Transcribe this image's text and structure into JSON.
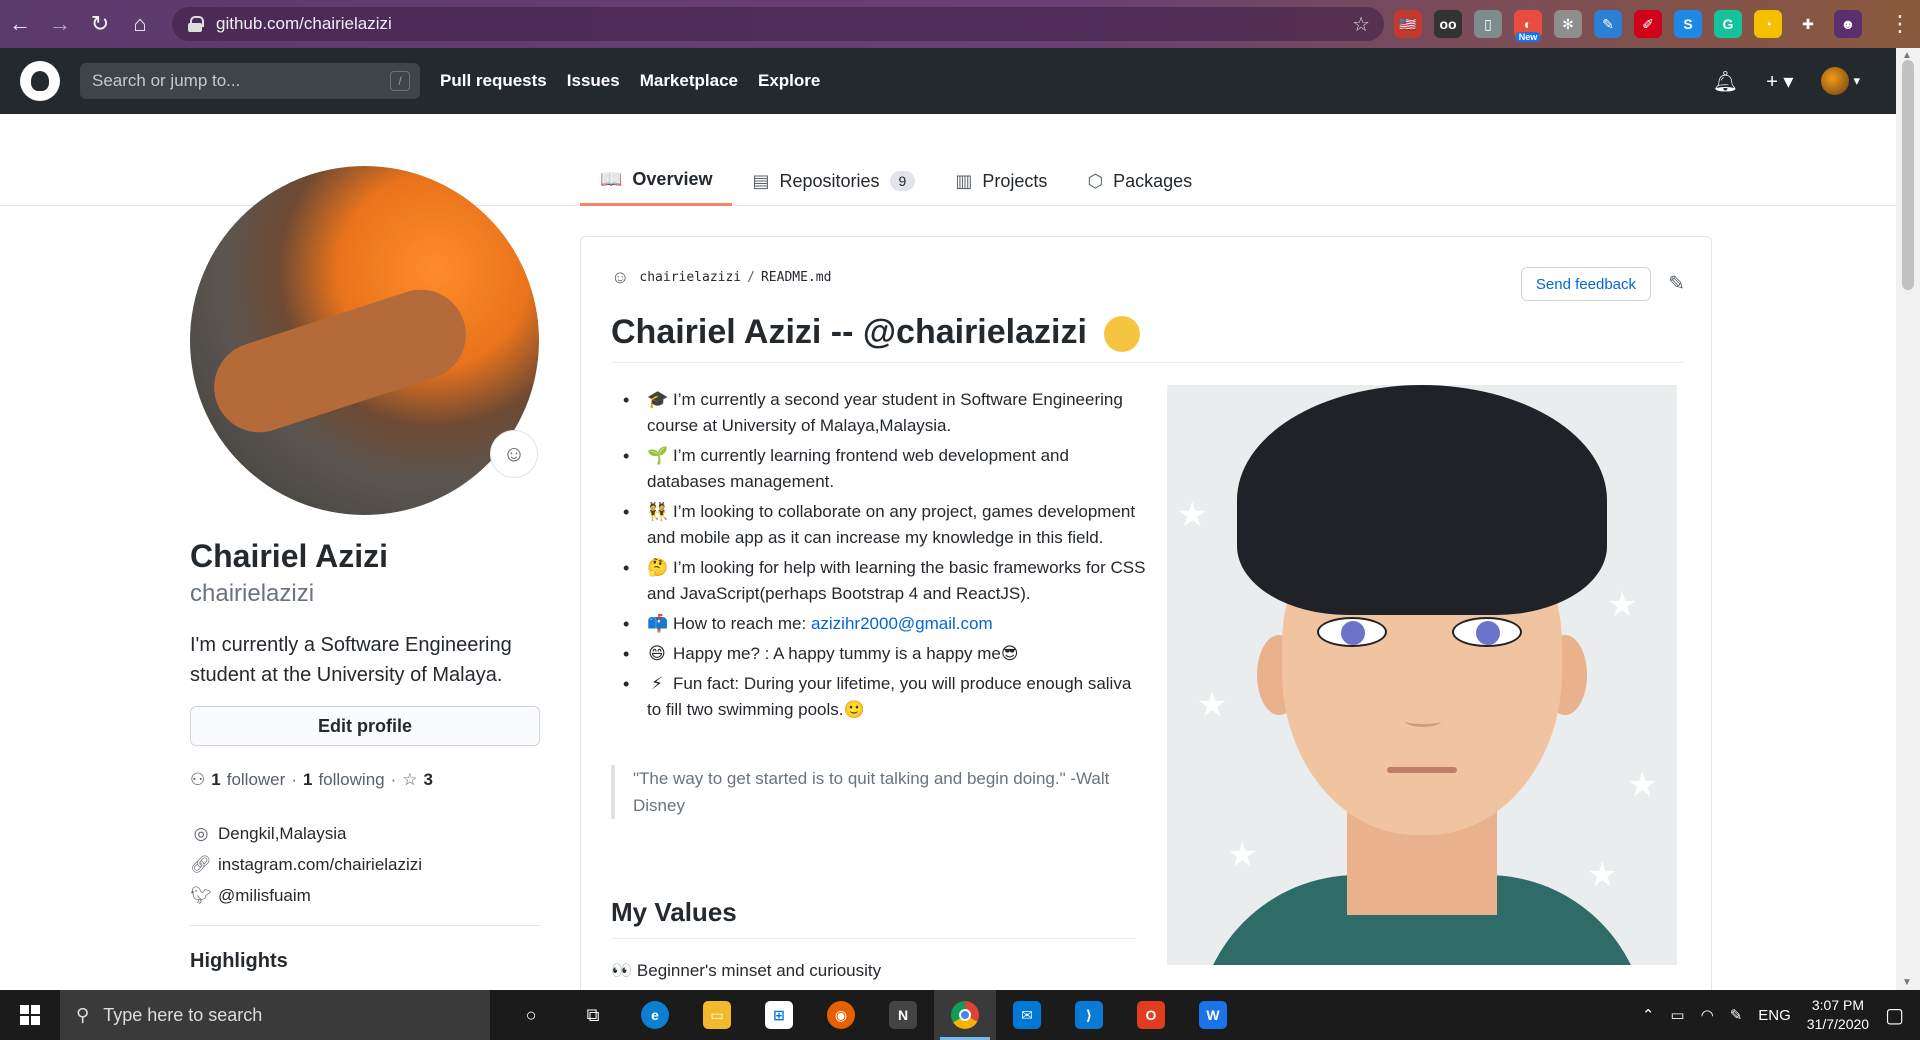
{
  "browser": {
    "url": "github.com/chairielazizi",
    "extensions": [
      {
        "name": "flag-extension",
        "color": "#c0392b",
        "label": "🇺🇸"
      },
      {
        "name": "glasses-extension",
        "color": "#333333",
        "label": "oo"
      },
      {
        "name": "doc-extension",
        "color": "#7f8c8d",
        "label": "▯"
      },
      {
        "name": "new-extension",
        "color": "#e74c3c",
        "label": "◐",
        "badge": "New"
      },
      {
        "name": "gear-extension",
        "color": "#8e8e8e",
        "label": "✻"
      },
      {
        "name": "feather-extension",
        "color": "#2d7fd3",
        "label": "✎"
      },
      {
        "name": "pdf-extension",
        "color": "#d0021b",
        "label": "✐"
      },
      {
        "name": "s-extension",
        "color": "#1e88e5",
        "label": "S"
      },
      {
        "name": "grammarly-extension",
        "color": "#15c39a",
        "label": "G"
      },
      {
        "name": "pacman-extension",
        "color": "#f5c000",
        "label": "◔"
      },
      {
        "name": "puzzle-extension",
        "color": "transparent",
        "label": "✚"
      },
      {
        "name": "profile-extension",
        "color": "#5a2f6e",
        "label": "☻"
      }
    ]
  },
  "gh": {
    "search_placeholder": "Search or jump to...",
    "slash": "/",
    "nav": [
      "Pull requests",
      "Issues",
      "Marketplace",
      "Explore"
    ],
    "plus": "+ ▾",
    "avatar_caret": "▾"
  },
  "tabs": [
    {
      "label": "Overview",
      "icon": "book-icon",
      "glyph": "📖",
      "active": true
    },
    {
      "label": "Repositories",
      "icon": "repo-icon",
      "glyph": "▤",
      "count": "9"
    },
    {
      "label": "Projects",
      "icon": "project-icon",
      "glyph": "▥"
    },
    {
      "label": "Packages",
      "icon": "package-icon",
      "glyph": "⬡"
    }
  ],
  "profile": {
    "fullname": "Chairiel Azizi",
    "username": "chairielazizi",
    "bio": "I'm currently a Software Engineering student at the University of Malaya.",
    "edit_label": "Edit profile",
    "followers": "1",
    "followers_label": "follower",
    "following": "1",
    "following_label": "following",
    "stars": "3",
    "location": "Dengkil,Malaysia",
    "website": "instagram.com/chairielazizi",
    "twitter": "@milisfuaim",
    "highlights": "Highlights"
  },
  "readme": {
    "owner": "chairielazizi",
    "sep": "/",
    "file": "README.md",
    "feedback": "Send feedback",
    "title": "Chairiel Azizi -- @chairielazizi",
    "bullets": [
      {
        "emoji": "🎓",
        "text": "I’m currently a second year student in Software Engineering course at University of Malaya,Malaysia."
      },
      {
        "emoji": "🌱",
        "text": "I’m currently learning frontend web development and databases management."
      },
      {
        "emoji": "👯",
        "text": "I’m looking to collaborate on any project, games development and mobile app as it can increase my knowledge in this field."
      },
      {
        "emoji": "🤔",
        "text": "I’m looking for help with learning the basic frameworks for CSS and JavaScript(perhaps Bootstrap 4 and ReactJS)."
      },
      {
        "emoji": "📫",
        "text": "How to reach me: ",
        "link": "azizihr2000@gmail.com"
      },
      {
        "emoji": "😄",
        "text": "Happy me? : A happy tummy is a happy me😎"
      },
      {
        "emoji": "⚡",
        "text": "Fun fact: During your lifetime, you will produce enough saliva to fill two swimming pools.🙂"
      }
    ],
    "quote": "\"The way to get started is to quit talking and begin doing.\" -Walt Disney",
    "values_heading": "My Values",
    "values_first": "Beginner's minset and curiousity",
    "values_first_emoji": "👀"
  },
  "taskbar": {
    "search_placeholder": "Type here to search",
    "lang": "ENG",
    "time": "3:07 PM",
    "date": "31/7/2020"
  }
}
